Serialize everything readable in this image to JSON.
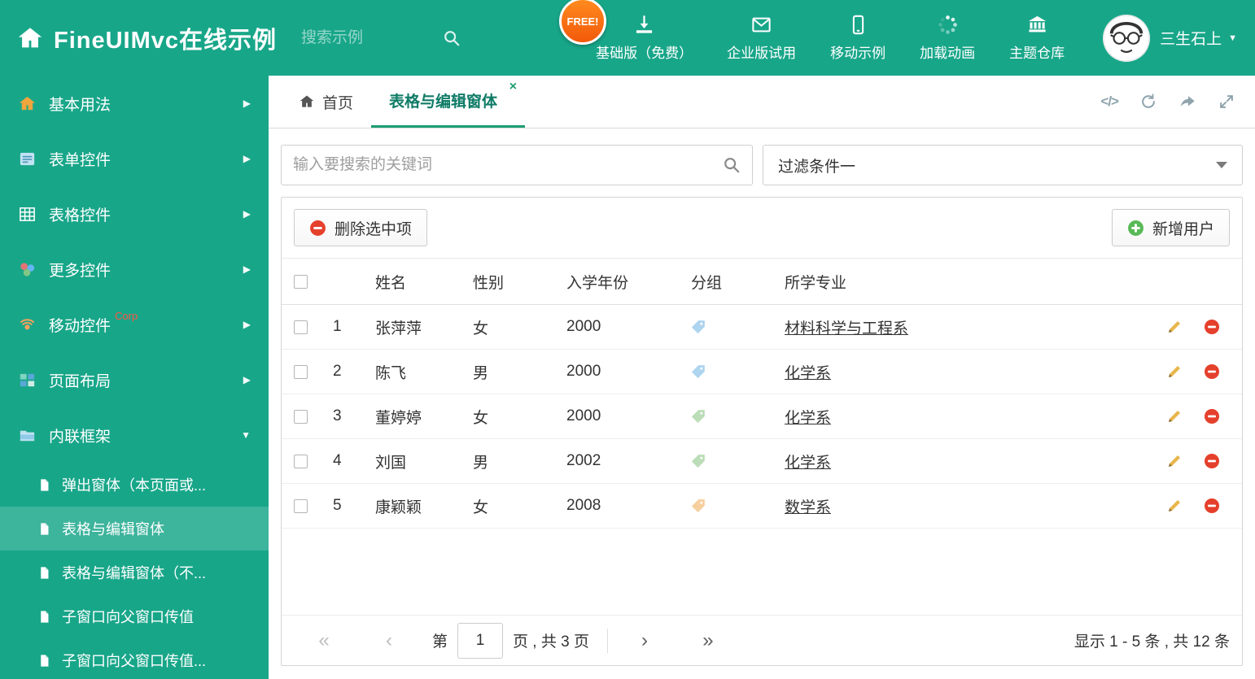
{
  "colors": {
    "primary": "#18A689",
    "tab_active": "#1D9D74",
    "free_badge": "#F2590A",
    "delete_red": "#E5402C",
    "add_green": "#58B957",
    "edit_yellow": "#E8B64C"
  },
  "header": {
    "title": "FineUIMvc在线示例",
    "search_placeholder": "搜索示例",
    "free_badge": "FREE!",
    "nav": [
      {
        "label": "基础版（免费）",
        "icon": "download-icon"
      },
      {
        "label": "企业版试用",
        "icon": "envelope-icon"
      },
      {
        "label": "移动示例",
        "icon": "mobile-icon"
      },
      {
        "label": "加载动画",
        "icon": "spinner-icon"
      },
      {
        "label": "主题仓库",
        "icon": "bank-icon"
      }
    ],
    "user": {
      "name": "三生石上"
    }
  },
  "sidebar": {
    "items": [
      {
        "label": "基本用法",
        "icon": "home-icon"
      },
      {
        "label": "表单控件",
        "icon": "form-icon"
      },
      {
        "label": "表格控件",
        "icon": "table-icon"
      },
      {
        "label": "更多控件",
        "icon": "widgets-icon"
      },
      {
        "label": "移动控件",
        "icon": "mobile-wave-icon",
        "badge": "Corp"
      },
      {
        "label": "页面布局",
        "icon": "layout-icon"
      },
      {
        "label": "内联框架",
        "icon": "frame-icon",
        "expanded": true
      }
    ],
    "submenu": [
      {
        "label": "弹出窗体（本页面或..."
      },
      {
        "label": "表格与编辑窗体",
        "selected": true
      },
      {
        "label": "表格与编辑窗体（不..."
      },
      {
        "label": "子窗口向父窗口传值"
      },
      {
        "label": "子窗口向父窗口传值..."
      }
    ]
  },
  "tabs": {
    "home_label": "首页",
    "active_label": "表格与编辑窗体"
  },
  "filters": {
    "search_placeholder": "输入要搜索的关键词",
    "dropdown_value": "过滤条件一"
  },
  "toolbar": {
    "delete_label": "删除选中项",
    "add_label": "新增用户"
  },
  "table": {
    "columns": [
      "姓名",
      "性别",
      "入学年份",
      "分组",
      "所学专业"
    ],
    "rows": [
      {
        "num": "1",
        "name": "张萍萍",
        "gender": "女",
        "year": "2000",
        "tag_style": "color:#6CB2E3",
        "major": "材料科学与工程系"
      },
      {
        "num": "2",
        "name": "陈飞",
        "gender": "男",
        "year": "2000",
        "tag_style": "color:#6CB2E3",
        "major": "化学系"
      },
      {
        "num": "3",
        "name": "董婷婷",
        "gender": "女",
        "year": "2000",
        "tag_style": "color:#85C27E",
        "major": "化学系"
      },
      {
        "num": "4",
        "name": "刘国",
        "gender": "男",
        "year": "2002",
        "tag_style": "color:#85C27E",
        "major": "化学系"
      },
      {
        "num": "5",
        "name": "康颖颖",
        "gender": "女",
        "year": "2008",
        "tag_style": "color:#EFA94F",
        "major": "数学系"
      }
    ]
  },
  "pagination": {
    "first": "«",
    "prev": "‹",
    "prefix": "第",
    "page_value": "1",
    "suffix": "页 , 共 3 页",
    "next": "›",
    "last": "»",
    "summary": "显示 1 - 5 条 , 共 12 条"
  },
  "icons": {
    "chevron_right": "▶",
    "chevron_down": "▼",
    "close": "×",
    "code": "</>"
  }
}
